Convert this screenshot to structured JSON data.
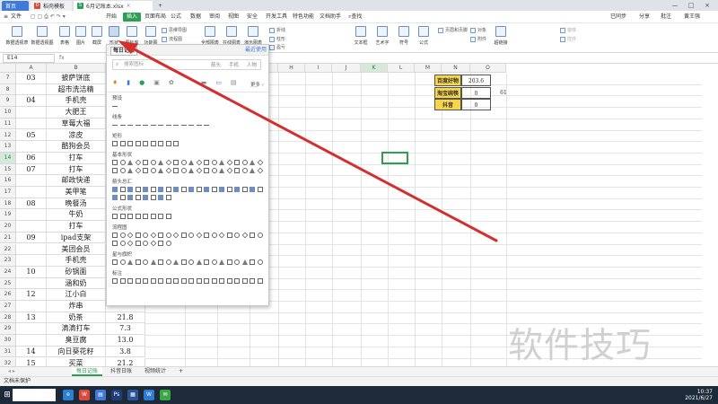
{
  "tabs": [
    {
      "label": "首页",
      "type": "home"
    },
    {
      "label": "稻壳模板",
      "type": "doc"
    },
    {
      "label": "6月记账本.xlsx",
      "type": "active"
    }
  ],
  "add_tab": "+",
  "menu": {
    "file": "文件",
    "items": [
      "开始",
      "插入",
      "页面布局",
      "公式",
      "数据",
      "审阅",
      "视图",
      "安全",
      "开发工具",
      "特色功能",
      "文档助手"
    ],
    "active": "插入",
    "search": "查找",
    "right": [
      "已同步",
      "分享",
      "批注"
    ],
    "user": "黄王强"
  },
  "ribbon": {
    "buttons": [
      "数据透视表",
      "数据透视图",
      "表格",
      "图片",
      "截屏",
      "形状",
      "图标库",
      "功能图",
      "思维导图",
      "流程图",
      "全部图表",
      "在线图表",
      "演示图表"
    ],
    "small": [
      "折线",
      "柱形",
      "盈亏"
    ],
    "right_buttons": [
      "文本框",
      "艺术字",
      "符号",
      "公式"
    ],
    "right_small": [
      "页眉和页脚",
      "对象",
      "附件",
      "超链接"
    ],
    "far_right": [
      "窗体",
      "控件"
    ]
  },
  "formula_bar": {
    "name_box": "E14",
    "fx": "fx"
  },
  "grid": {
    "columns": [
      "A",
      "B",
      "C",
      "D",
      "E",
      "F",
      "G",
      "H",
      "I",
      "J",
      "K",
      "L",
      "M",
      "N",
      "O"
    ],
    "selected_column": "K",
    "rows": [
      {
        "n": "7",
        "a": "03",
        "b": "披萨饼底",
        "c": ""
      },
      {
        "n": "8",
        "a": "",
        "b": "超市洗洁精",
        "c": ""
      },
      {
        "n": "9",
        "a": "04",
        "b": "手机壳",
        "c": ""
      },
      {
        "n": "10",
        "a": "",
        "b": "大肥王",
        "c": ""
      },
      {
        "n": "11",
        "a": "",
        "b": "草莓大福",
        "c": ""
      },
      {
        "n": "12",
        "a": "05",
        "b": "凉皮",
        "c": ""
      },
      {
        "n": "13",
        "a": "",
        "b": "酷狗会员",
        "c": ""
      },
      {
        "n": "14",
        "a": "06",
        "b": "打车",
        "c": ""
      },
      {
        "n": "15",
        "a": "07",
        "b": "打车",
        "c": ""
      },
      {
        "n": "16",
        "a": "",
        "b": "邮政快递",
        "c": ""
      },
      {
        "n": "17",
        "a": "",
        "b": "美甲笔",
        "c": ""
      },
      {
        "n": "18",
        "a": "08",
        "b": "晚餐汤",
        "c": ""
      },
      {
        "n": "19",
        "a": "",
        "b": "牛奶",
        "c": ""
      },
      {
        "n": "20",
        "a": "",
        "b": "打车",
        "c": ""
      },
      {
        "n": "21",
        "a": "09",
        "b": "ipad支架",
        "c": ""
      },
      {
        "n": "22",
        "a": "",
        "b": "美团会员",
        "c": ""
      },
      {
        "n": "23",
        "a": "",
        "b": "手机壳",
        "c": ""
      },
      {
        "n": "24",
        "a": "10",
        "b": "砂锅面",
        "c": ""
      },
      {
        "n": "25",
        "a": "",
        "b": "涵和奶",
        "c": ""
      },
      {
        "n": "26",
        "a": "12",
        "b": "江小白",
        "c": ""
      },
      {
        "n": "27",
        "a": "",
        "b": "炸串",
        "c": ""
      },
      {
        "n": "28",
        "a": "13",
        "b": "奶茶",
        "c": "21.8"
      },
      {
        "n": "29",
        "a": "",
        "b": "滴滴打车",
        "c": "7.3"
      },
      {
        "n": "30",
        "a": "",
        "b": "臭豆腐",
        "c": "13.0"
      },
      {
        "n": "31",
        "a": "14",
        "b": "向日葵花籽",
        "c": "3.8"
      },
      {
        "n": "32",
        "a": "15",
        "b": "买菜",
        "c": "21.2"
      }
    ],
    "side_table": [
      {
        "label": "百度好物",
        "value": "203.6",
        "extra": ""
      },
      {
        "label": "淘宝碗筷",
        "value": "0",
        "extra": "61"
      },
      {
        "label": "抖音",
        "value": "0",
        "extra": ""
      }
    ]
  },
  "shapes_panel": {
    "tabs": [
      "每日记账",
      "最近使用"
    ],
    "search_placeholder": "搜索图标",
    "filters": [
      "箭头",
      "手机",
      "人物"
    ],
    "more": "更多",
    "sections": [
      "预设",
      "线条",
      "矩形",
      "基本形状",
      "箭头总汇",
      "公式形状",
      "流程图",
      "星与旗帜",
      "标注"
    ]
  },
  "sheet_tabs": [
    "每日记账",
    "抖音日账",
    "视频统计"
  ],
  "add_sheet": "+",
  "status": {
    "text": "文档未保护"
  },
  "watermark": "软件技巧",
  "taskbar": {
    "time": "10:37",
    "date": "2021/6/27"
  },
  "colors": {
    "accent": "#2f9e55",
    "arrow": "#d32f2f",
    "highlight": "#f7d44a"
  }
}
